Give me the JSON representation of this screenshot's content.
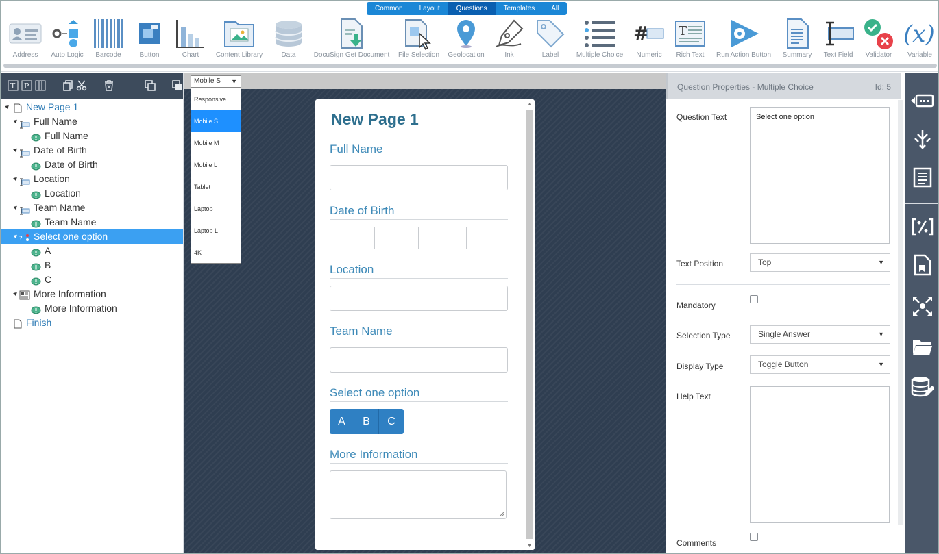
{
  "tabs": [
    {
      "label": "Common",
      "active": false
    },
    {
      "label": "Layout",
      "active": false
    },
    {
      "label": "Questions",
      "active": true
    },
    {
      "label": "Templates",
      "active": false
    },
    {
      "label": "All",
      "active": false
    }
  ],
  "tools": [
    {
      "label": "Address",
      "icon": "address-card-icon"
    },
    {
      "label": "Auto Logic",
      "icon": "auto-logic-icon"
    },
    {
      "label": "Barcode",
      "icon": "barcode-icon"
    },
    {
      "label": "Button",
      "icon": "button-icon"
    },
    {
      "label": "Chart",
      "icon": "chart-icon"
    },
    {
      "label": "Content Library",
      "icon": "content-library-icon"
    },
    {
      "label": "Data",
      "icon": "database-icon"
    },
    {
      "label": "DocuSign Get Document",
      "icon": "docusign-icon"
    },
    {
      "label": "File Selection",
      "icon": "file-selection-icon"
    },
    {
      "label": "Geolocation",
      "icon": "map-pin-icon"
    },
    {
      "label": "Ink",
      "icon": "pen-nib-icon"
    },
    {
      "label": "Label",
      "icon": "tag-icon"
    },
    {
      "label": "Multiple Choice",
      "icon": "list-icon"
    },
    {
      "label": "Numeric",
      "icon": "hash-icon"
    },
    {
      "label": "Rich Text",
      "icon": "rich-text-icon"
    },
    {
      "label": "Run Action Button",
      "icon": "run-action-icon"
    },
    {
      "label": "Summary",
      "icon": "summary-icon"
    },
    {
      "label": "Text Field",
      "icon": "text-field-icon"
    },
    {
      "label": "Validator",
      "icon": "validator-icon"
    },
    {
      "label": "Variable",
      "icon": "variable-icon"
    }
  ],
  "tree": {
    "items": [
      {
        "label": "New Page 1",
        "type": "page"
      },
      {
        "label": "Full Name",
        "type": "question"
      },
      {
        "label": "Full Name",
        "type": "label"
      },
      {
        "label": "Date of Birth",
        "type": "question"
      },
      {
        "label": "Date of Birth",
        "type": "label"
      },
      {
        "label": "Location",
        "type": "question"
      },
      {
        "label": "Location",
        "type": "label"
      },
      {
        "label": "Team Name",
        "type": "question"
      },
      {
        "label": "Team Name",
        "type": "label"
      },
      {
        "label": "Select one option",
        "type": "question-selected"
      },
      {
        "label": "A",
        "type": "label"
      },
      {
        "label": "B",
        "type": "label"
      },
      {
        "label": "C",
        "type": "label"
      },
      {
        "label": "More Information",
        "type": "question-rich"
      },
      {
        "label": "More Information",
        "type": "label"
      },
      {
        "label": "Finish",
        "type": "page"
      }
    ]
  },
  "canvas": {
    "device_selected": "Mobile S",
    "device_options": [
      "Responsive",
      "Mobile S",
      "Mobile M",
      "Mobile L",
      "Tablet",
      "Laptop",
      "Laptop L",
      "4K"
    ]
  },
  "form": {
    "title": "New Page 1",
    "fields": {
      "full_name": "Full Name",
      "date_of_birth": "Date of Birth",
      "location": "Location",
      "team_name": "Team Name",
      "select_option": "Select one option",
      "more_info": "More Information"
    },
    "options": [
      "A",
      "B",
      "C"
    ]
  },
  "properties": {
    "header": "Question Properties - Multiple Choice",
    "id": "Id: 5",
    "question_text_label": "Question Text",
    "question_text_value": "Select one option",
    "text_position_label": "Text Position",
    "text_position_value": "Top",
    "mandatory_label": "Mandatory",
    "mandatory_checked": false,
    "selection_type_label": "Selection Type",
    "selection_type_value": "Single Answer",
    "display_type_label": "Display Type",
    "display_type_value": "Toggle Button",
    "help_text_label": "Help Text",
    "help_text_value": "",
    "comments_label": "Comments",
    "comments_checked": false
  },
  "colors": {
    "accent": "#1b87d6",
    "selected_row": "#3ba0f2",
    "toggle": "#2f80c3",
    "sidebar": "#4a5769",
    "canvas_bg": "#2f3e51"
  }
}
